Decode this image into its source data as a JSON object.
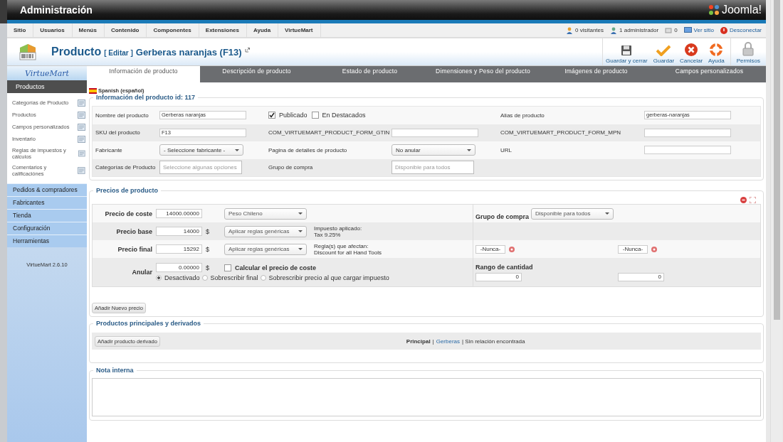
{
  "header": {
    "title": "Administración",
    "logo_text": "Joomla!"
  },
  "menu": [
    "Sitio",
    "Usuarios",
    "Menús",
    "Contenido",
    "Componentes",
    "Extensiones",
    "Ayuda",
    "VirtueMart"
  ],
  "status": [
    {
      "kind": "visitors",
      "text": "0 visitantes"
    },
    {
      "kind": "admins",
      "text": "1 administrador"
    },
    {
      "kind": "messages",
      "text": "0"
    },
    {
      "kind": "site",
      "text": "Ver sitio"
    },
    {
      "kind": "logout",
      "text": "Desconectar"
    }
  ],
  "page_title": {
    "title": "Producto",
    "action": "[ Editar ]",
    "name": "Gerberas naranjas (F13)"
  },
  "toolbar": [
    {
      "kind": "save",
      "label": "Guardar y cerrar"
    },
    {
      "kind": "apply",
      "label": "Guardar"
    },
    {
      "kind": "cancel",
      "label": "Cancelar"
    },
    {
      "kind": "help",
      "label": "Ayuda"
    },
    {
      "kind": "lock",
      "label": "Permisos"
    }
  ],
  "sidebar": {
    "logo": "VirtueMart",
    "active_section": "Productos",
    "items": [
      "Categorías de Producto",
      "Productos",
      "Campos personalizados",
      "Inventario",
      "Reglas de impuestos y cálculos",
      "Comentarios y calificaciónes"
    ],
    "sections": [
      "Pedidos & compradores",
      "Fabricantes",
      "Tienda",
      "Configuración",
      "Herramientas"
    ],
    "version": "VirtueMart 2.6.10"
  },
  "tabs": [
    {
      "label": "Información de producto",
      "selected": true
    },
    {
      "label": "Descripción de producto",
      "selected": false
    },
    {
      "label": "Estado de producto",
      "selected": false
    },
    {
      "label": "Dimensiones y Peso del producto",
      "selected": false
    },
    {
      "label": "Imágenes de producto",
      "selected": false
    },
    {
      "label": "Campos personalizados",
      "selected": false
    }
  ],
  "language": "Spanish (español)",
  "info": {
    "legend": "Información del producto id: 117",
    "rows": [
      [
        {
          "kind": "label",
          "text": "Nombre del producto"
        },
        {
          "kind": "input",
          "value": "Gerberas naranjas"
        },
        {
          "kind": "checks",
          "items": [
            {
              "label": "Publicado",
              "checked": true
            },
            {
              "label": "En Destacados",
              "checked": false
            }
          ]
        },
        {
          "kind": "empty"
        },
        {
          "kind": "label",
          "text": "Alias de producto"
        },
        {
          "kind": "input",
          "value": "gerberas-naranjas"
        }
      ],
      [
        {
          "kind": "label",
          "text": "SKU del producto"
        },
        {
          "kind": "input",
          "value": "F13"
        },
        {
          "kind": "label",
          "text": "COM_VIRTUEMART_PRODUCT_FORM_GTIN"
        },
        {
          "kind": "input"
        },
        {
          "kind": "label",
          "text": "COM_VIRTUEMART_PRODUCT_FORM_MPN"
        },
        {
          "kind": "input"
        }
      ],
      [
        {
          "kind": "label",
          "text": "Fabricante"
        },
        {
          "kind": "select",
          "value": "- Seleccione fabricante -"
        },
        {
          "kind": "label",
          "text": "Pagina de detalles de producto"
        },
        {
          "kind": "select",
          "value": "No anular"
        },
        {
          "kind": "label",
          "text": "URL"
        },
        {
          "kind": "input"
        }
      ],
      [
        {
          "kind": "label",
          "text": "Categorías de Producto"
        },
        {
          "kind": "multi",
          "placeholder": "Seleccione algunas opciones"
        },
        {
          "kind": "label",
          "text": "Grupo de compra"
        },
        {
          "kind": "multi",
          "placeholder": "Disponible para todos"
        }
      ]
    ]
  },
  "prices": {
    "legend": "Precios de producto",
    "rows": [
      {
        "kind": "price",
        "label": "Precio de coste",
        "value": "14000.00000",
        "select": "Peso Chileno",
        "right": {
          "kind": "group",
          "label": "Grupo de compra",
          "select": "Disponible para todos"
        }
      },
      {
        "kind": "price",
        "label": "Precio base",
        "value": "14000",
        "currency": "$",
        "select": "Aplicar reglas genéricas",
        "note": [
          "Impuesto aplicado:",
          "Tax 9.25%"
        ]
      },
      {
        "kind": "price",
        "label": "Precio final",
        "value": "15292",
        "currency": "$",
        "select": "Aplicar reglas genéricas",
        "note": [
          "Regla(s) que afectan:",
          "Discount for all Hand Tools"
        ],
        "right": {
          "kind": "dates",
          "values": [
            "-Nunca-",
            "-Nunca-"
          ]
        }
      },
      {
        "kind": "override",
        "label": "Anular",
        "value": "0.00000",
        "currency": "$",
        "check": {
          "label": "Calcular el precio de coste",
          "checked": false
        },
        "options": [
          {
            "label": "Desactivado",
            "selected": true
          },
          {
            "label": "Sobrescribir final",
            "selected": false
          },
          {
            "label": "Sobrescribir precio al que cargar impuesto",
            "selected": false
          }
        ],
        "right": {
          "kind": "range",
          "label": "Rango de cantidad",
          "values": [
            "0",
            "0"
          ]
        }
      }
    ],
    "button": "Añadir Nuevo precio"
  },
  "derived": {
    "legend": "Productos principales y derivados",
    "button": "Añadir producto derivado",
    "label": "Principal",
    "sep": "|",
    "link": "Gerberas",
    "rest": "| Sin relación encontrada"
  },
  "note": {
    "legend": "Nota interna"
  }
}
